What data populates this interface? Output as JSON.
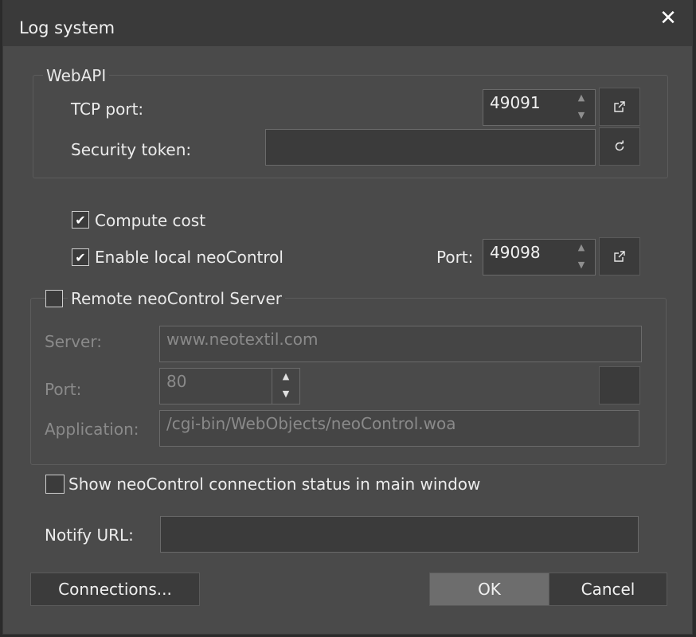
{
  "window": {
    "title": "Log system",
    "close_glyph": "✕"
  },
  "webapi": {
    "legend": "WebAPI",
    "tcp_port_label": "TCP port:",
    "tcp_port_value": "49091",
    "security_token_label": "Security token:",
    "security_token_value": ""
  },
  "options": {
    "compute_cost_label": "Compute cost",
    "compute_cost_checked": true,
    "enable_local_label": "Enable local neoControl",
    "enable_local_checked": true,
    "local_port_label": "Port:",
    "local_port_value": "49098"
  },
  "remote": {
    "legend": "Remote neoControl Server",
    "checked": false,
    "server_label": "Server:",
    "server_placeholder": "www.neotextil.com",
    "port_label": "Port:",
    "port_value": "80",
    "application_label": "Application:",
    "application_placeholder": "/cgi-bin/WebObjects/neoControl.woa"
  },
  "status": {
    "show_status_label": "Show neoControl connection status in main window",
    "show_status_checked": false,
    "notify_url_label": "Notify URL:",
    "notify_url_value": ""
  },
  "footer": {
    "connections_label": "Connections...",
    "ok_label": "OK",
    "cancel_label": "Cancel"
  },
  "icons": {
    "spin_up": "▲",
    "spin_down": "▼",
    "external_link": "external-link-icon",
    "refresh": "refresh-icon",
    "check": "✔"
  },
  "colors": {
    "primary_button": "#6d6d6d",
    "background": "#4a4a4a"
  }
}
